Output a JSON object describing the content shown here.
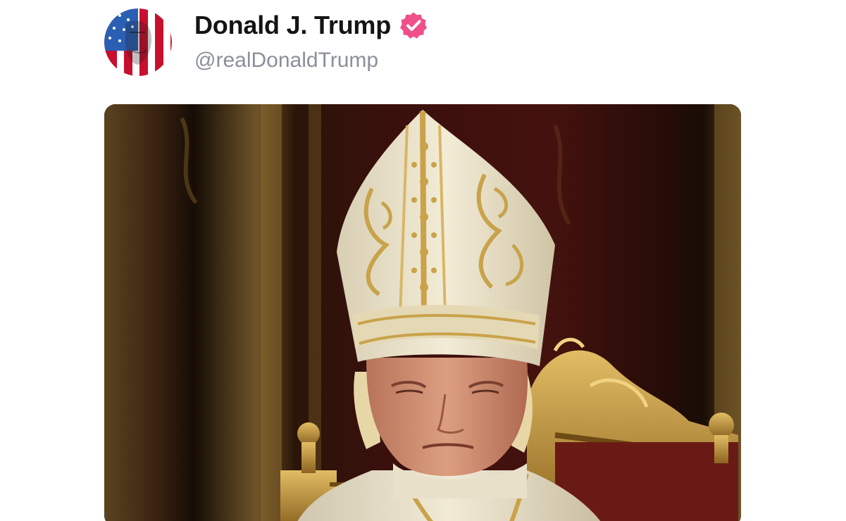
{
  "post": {
    "author": {
      "display_name": "Donald J. Trump",
      "handle": "@realDonaldTrump",
      "avatar_icon": "flag-portrait-avatar",
      "verified_icon": "verified-badge-icon",
      "verified_color": "#f0508a"
    },
    "media": {
      "icon": "portrait-image",
      "background_color": "#2a1208",
      "accent_gold": "#c9a24a",
      "mitre_color": "#ece4cc"
    }
  }
}
